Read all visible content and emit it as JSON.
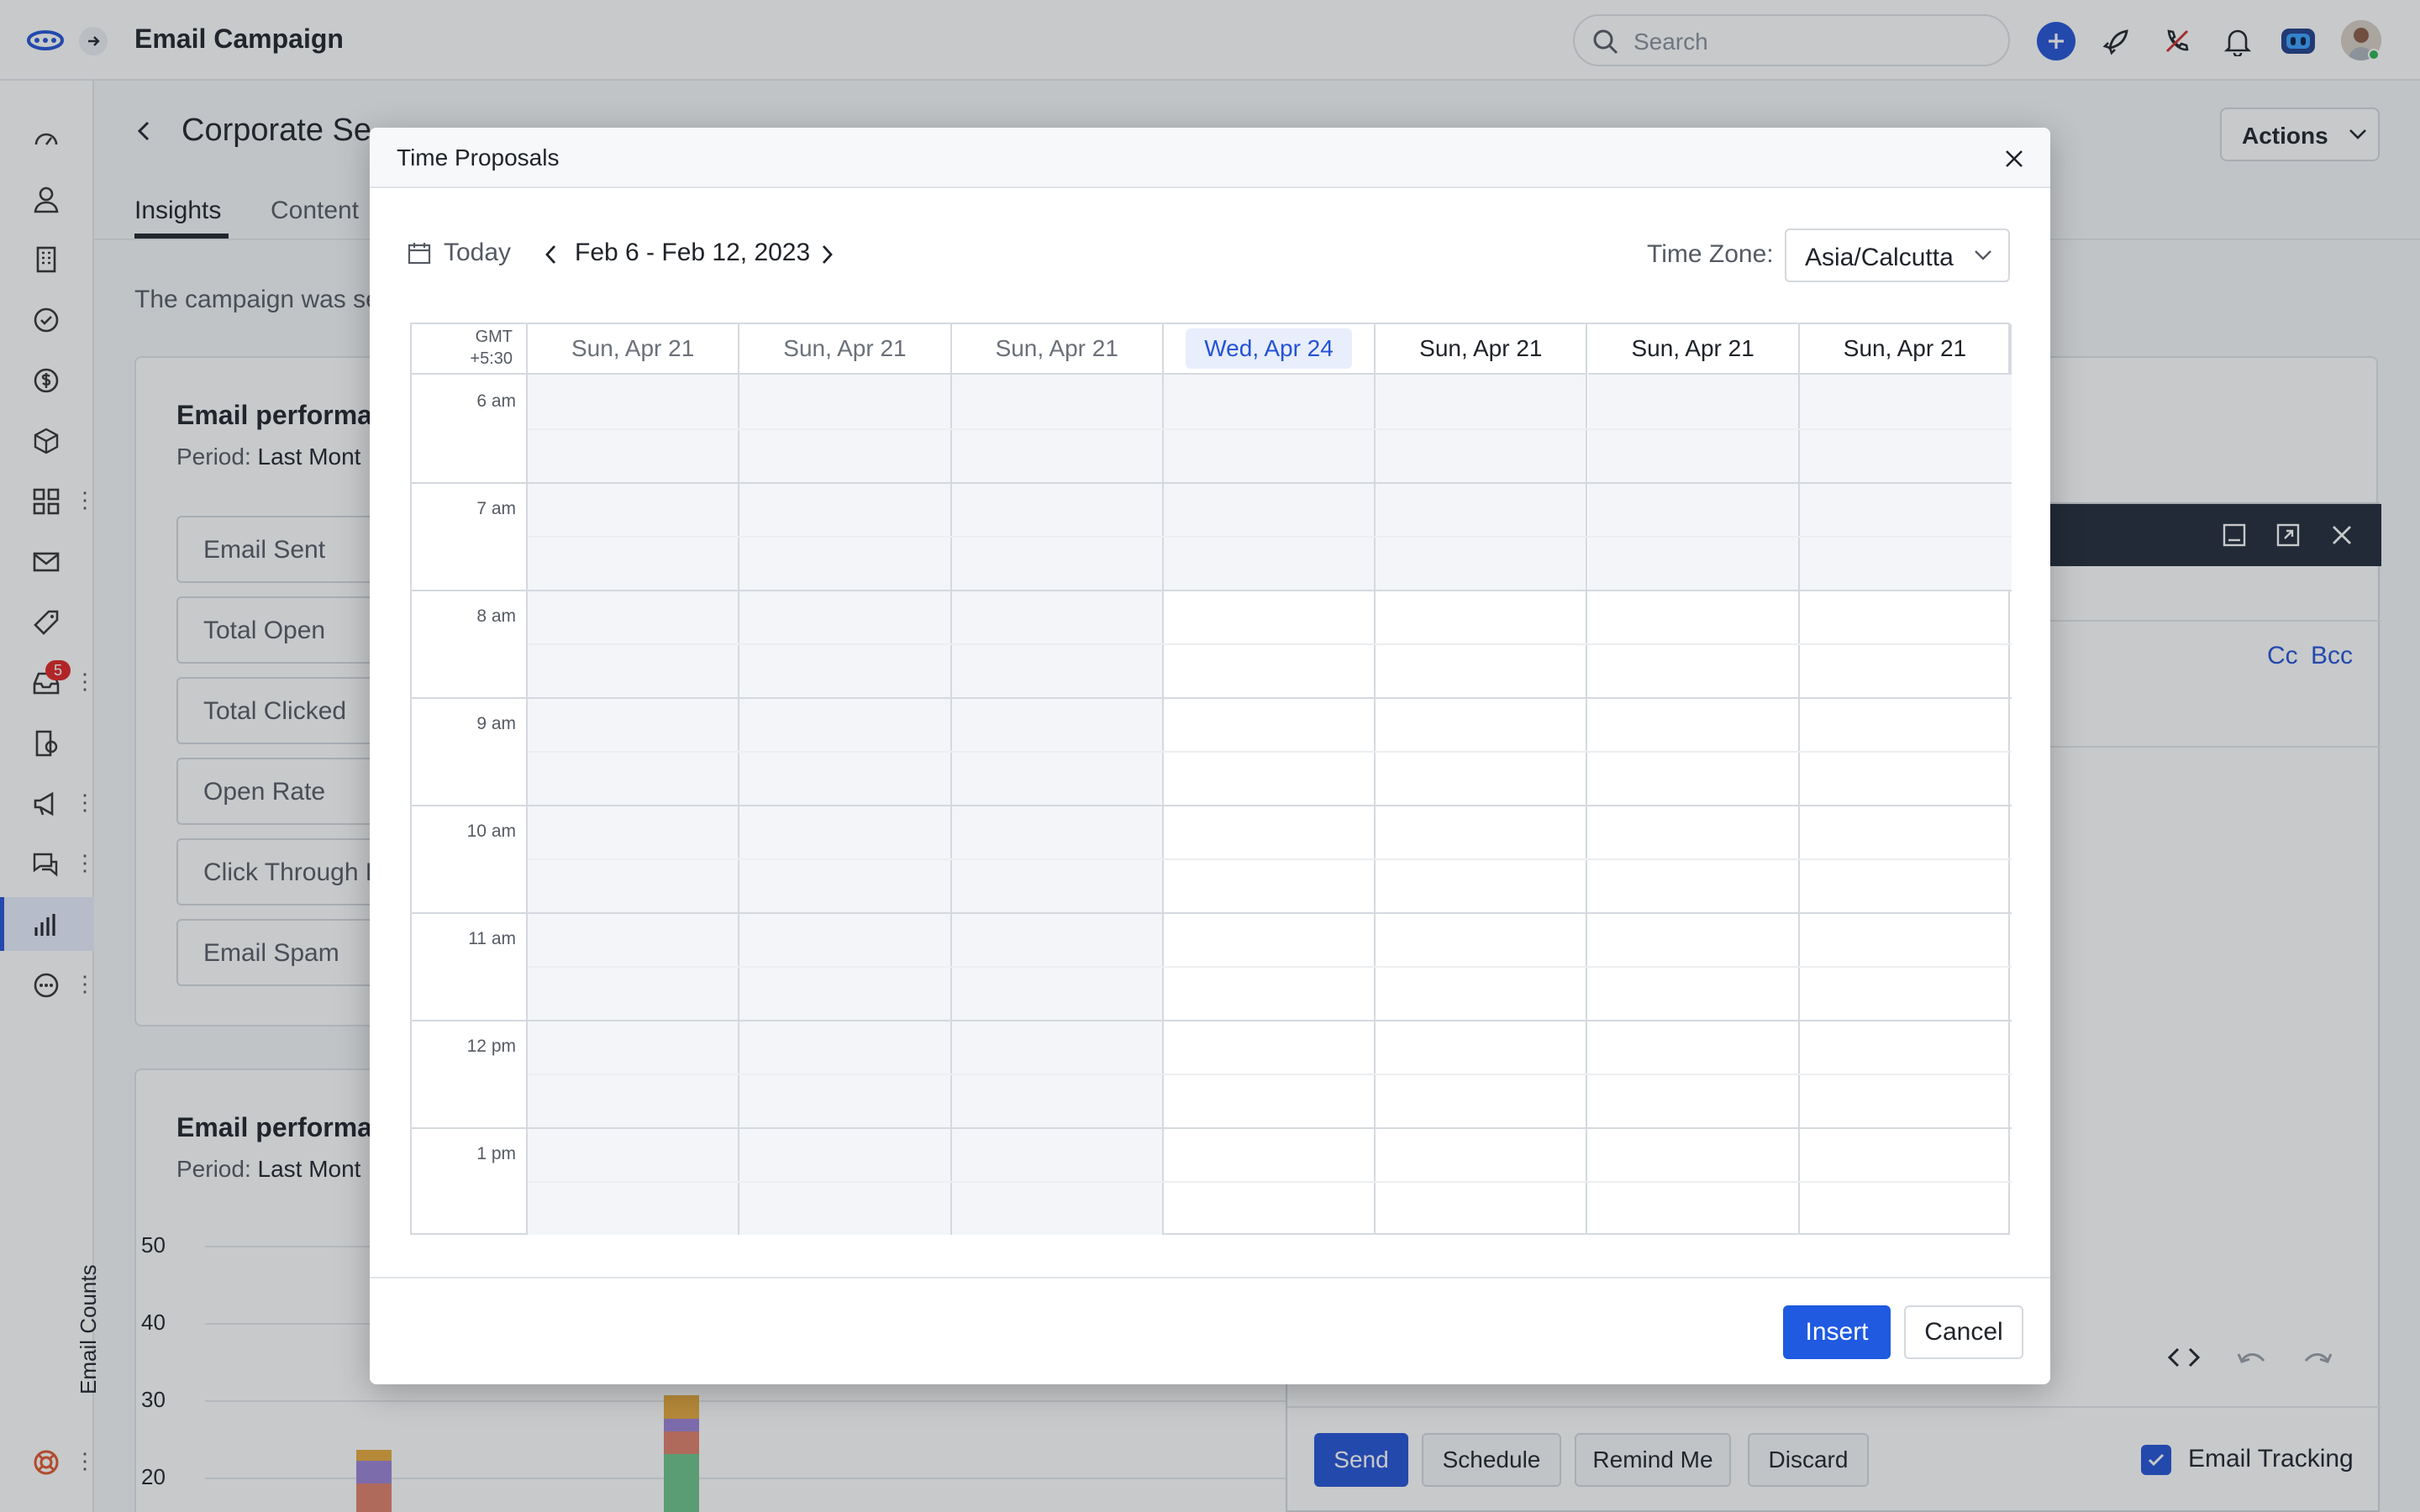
{
  "topbar": {
    "title": "Email Campaign",
    "search_placeholder": "Search"
  },
  "leftnav": {
    "badge": "5",
    "items": [
      "dashboard-icon",
      "contact-icon",
      "building-icon",
      "check-circle-icon",
      "dollar-icon",
      "cube-icon",
      "apps-icon",
      "mail-icon",
      "tag-icon",
      "inbox-icon",
      "report-icon",
      "megaphone-icon",
      "chat-icon",
      "analytics-icon",
      "more-circle-icon"
    ]
  },
  "page": {
    "title": "Corporate Se",
    "actions_label": "Actions",
    "tabs": [
      "Insights",
      "Content"
    ],
    "campaign_text": "The campaign was se",
    "card1": {
      "title": "Email performa",
      "period_label": "Period:",
      "period_value": "Last Mont",
      "metrics": [
        "Email Sent",
        "Total Open",
        "Total Clicked",
        "Open Rate",
        "Click Through R",
        "Email Spam"
      ]
    },
    "card2": {
      "title": "Email performa",
      "period_label": "Period:",
      "period_value": "Last Mont",
      "ylabel": "Email Counts",
      "yticks": [
        "50",
        "40",
        "30",
        "20"
      ]
    }
  },
  "chart_data": {
    "type": "bar",
    "ylabel": "Email Counts",
    "ylim": [
      0,
      50
    ],
    "yticks": [
      50,
      40,
      30,
      20
    ],
    "stacked": true,
    "series_colors": [
      "#e8a93b",
      "#9b82d6",
      "#e07f6a",
      "#6cc48a"
    ],
    "visible_bars": [
      {
        "segments": [
          {
            "color": "#e8a93b",
            "value": 1.4
          },
          {
            "color": "#9b82d6",
            "value": 3
          },
          {
            "color": "#e07f6a",
            "value": 4
          }
        ]
      },
      {
        "segments": [
          {
            "color": "#e8a93b",
            "value": 3
          },
          {
            "color": "#9b82d6",
            "value": 1.6
          },
          {
            "color": "#e07f6a",
            "value": 3
          },
          {
            "color": "#6cc48a",
            "value": 8
          }
        ]
      }
    ]
  },
  "compose": {
    "cc": "Cc",
    "bcc": "Bcc",
    "buttons": [
      "Send",
      "Schedule",
      "Remind Me",
      "Discard"
    ],
    "tracking_label": "Email Tracking",
    "tracking_checked": true
  },
  "modal": {
    "title": "Time Proposals",
    "today_label": "Today",
    "range": "Feb 6 - Feb 12, 2023",
    "tz_label": "Time Zone:",
    "tz_value": "Asia/Calcutta",
    "gmt_line1": "GMT",
    "gmt_line2": "+5:30",
    "days": [
      {
        "label": "Sun, Apr 21",
        "state": "past"
      },
      {
        "label": "Sun, Apr 21",
        "state": "past"
      },
      {
        "label": "Sun, Apr 21",
        "state": "past"
      },
      {
        "label": "Wed, Apr 24",
        "state": "today"
      },
      {
        "label": "Sun, Apr 21",
        "state": "future"
      },
      {
        "label": "Sun, Apr 21",
        "state": "future"
      },
      {
        "label": "Sun, Apr 21",
        "state": "future"
      }
    ],
    "hours": [
      "6 am",
      "7 am",
      "8 am",
      "9 am",
      "10 am",
      "11 am",
      "12 pm",
      "1 pm"
    ],
    "insert_label": "Insert",
    "cancel_label": "Cancel"
  },
  "colors": {
    "accent": "#2453d6",
    "primary_button": "#1f5ae0",
    "compose_header": "#1f2936",
    "past_shade": "#f3f5f8"
  }
}
